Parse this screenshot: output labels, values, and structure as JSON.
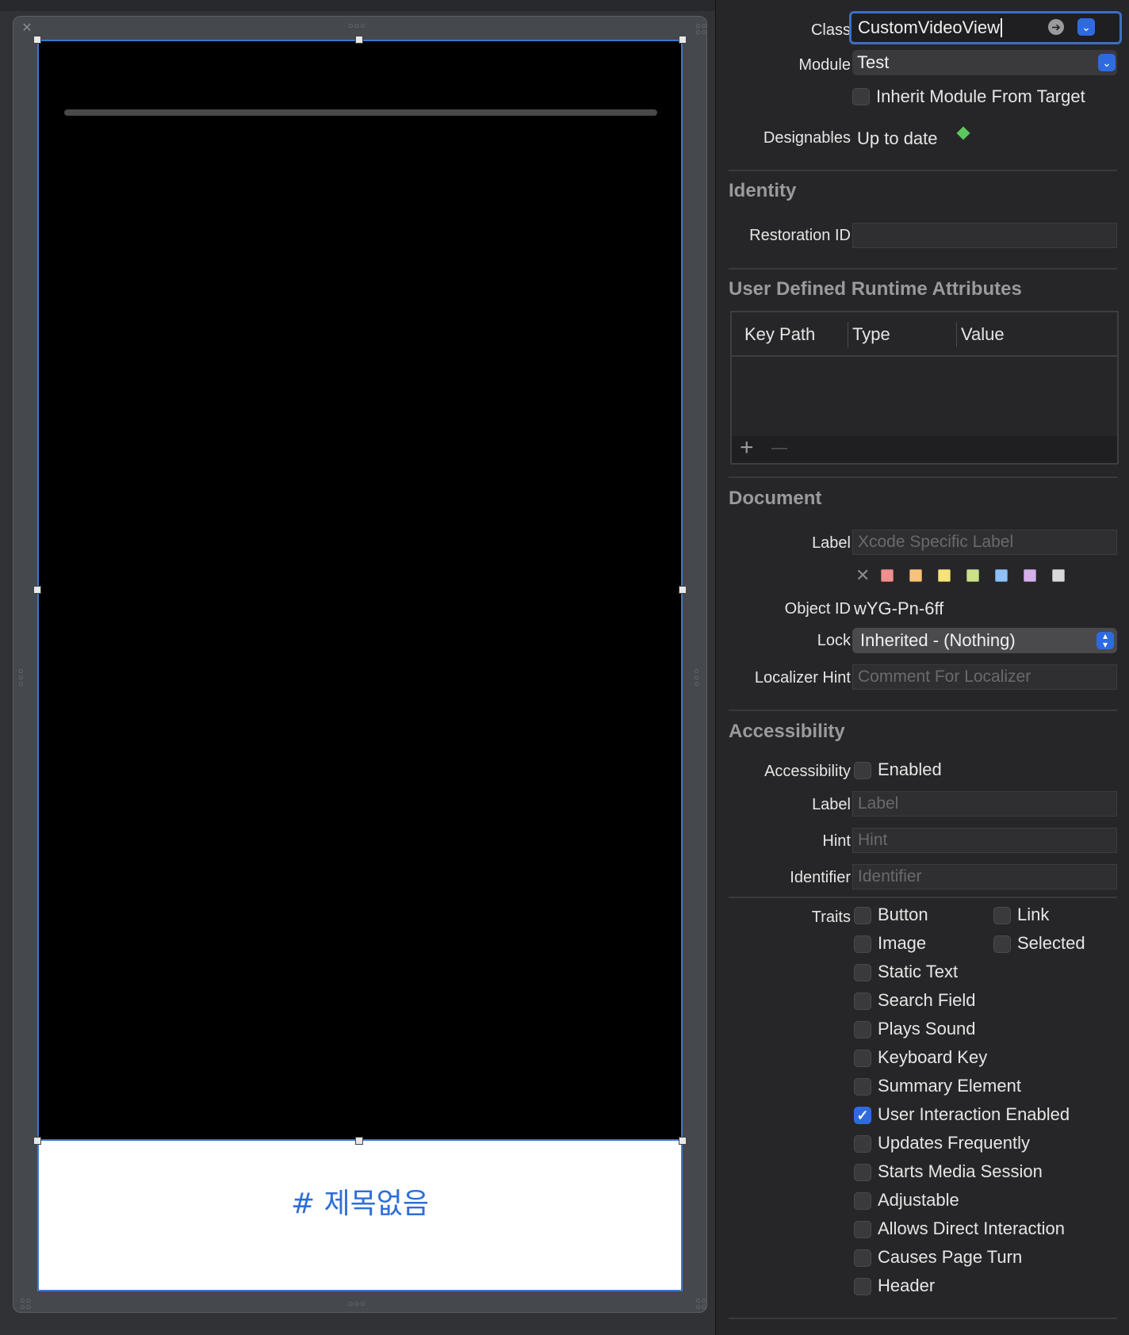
{
  "canvas": {
    "scene_hashtag": "# 제목없음"
  },
  "custom_class": {
    "class_label": "Class",
    "class_value": "CustomVideoView",
    "module_label": "Module",
    "module_value": "Test",
    "inherit_label": "Inherit Module From Target",
    "designables_label": "Designables",
    "designables_value": "Up to date"
  },
  "identity": {
    "title": "Identity",
    "restoration_label": "Restoration ID",
    "restoration_value": ""
  },
  "runtime_attributes": {
    "title": "User Defined Runtime Attributes",
    "columns": [
      "Key Path",
      "Type",
      "Value"
    ],
    "add_label": "+",
    "remove_label": "—"
  },
  "document": {
    "title": "Document",
    "label_label": "Label",
    "label_placeholder": "Xcode Specific Label",
    "label_colors": [
      "#f0908c",
      "#f7c27a",
      "#f5e27a",
      "#cce08a",
      "#8fc1f5",
      "#d6b0ea",
      "#d8d8d8"
    ],
    "object_id_label": "Object ID",
    "object_id_value": "wYG-Pn-6ff",
    "lock_label": "Lock",
    "lock_value": "Inherited - (Nothing)",
    "localizer_label": "Localizer Hint",
    "localizer_placeholder": "Comment For Localizer"
  },
  "accessibility": {
    "title": "Accessibility",
    "accessibility_label": "Accessibility",
    "enabled_label": "Enabled",
    "label_label": "Label",
    "label_placeholder": "Label",
    "hint_label": "Hint",
    "hint_placeholder": "Hint",
    "identifier_label": "Identifier",
    "identifier_placeholder": "Identifier",
    "traits_label": "Traits",
    "traits": [
      {
        "label": "Button",
        "checked": false
      },
      {
        "label": "Link",
        "checked": false
      },
      {
        "label": "Image",
        "checked": false
      },
      {
        "label": "Selected",
        "checked": false
      },
      {
        "label": "Static Text",
        "checked": false
      },
      {
        "label": "Search Field",
        "checked": false
      },
      {
        "label": "Plays Sound",
        "checked": false
      },
      {
        "label": "Keyboard Key",
        "checked": false
      },
      {
        "label": "Summary Element",
        "checked": false
      },
      {
        "label": "User Interaction Enabled",
        "checked": true
      },
      {
        "label": "Updates Frequently",
        "checked": false
      },
      {
        "label": "Starts Media Session",
        "checked": false
      },
      {
        "label": "Adjustable",
        "checked": false
      },
      {
        "label": "Allows Direct Interaction",
        "checked": false
      },
      {
        "label": "Causes Page Turn",
        "checked": false
      },
      {
        "label": "Header",
        "checked": false
      }
    ]
  },
  "colors": {
    "accent": "#2f6be0",
    "selection_outline": "#3f78c8",
    "hashtag_text": "#2e6fd8",
    "designables_ok": "#5cc85c"
  }
}
